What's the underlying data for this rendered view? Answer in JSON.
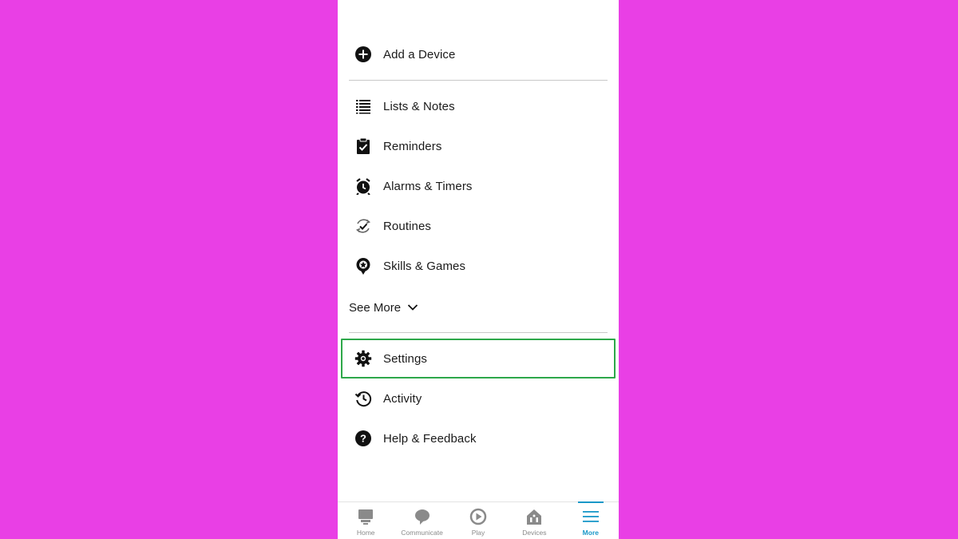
{
  "menu": {
    "add_device": "Add a Device",
    "items": [
      {
        "label": "Lists & Notes",
        "icon": "list-icon"
      },
      {
        "label": "Reminders",
        "icon": "clipboard-check-icon"
      },
      {
        "label": "Alarms & Timers",
        "icon": "alarm-clock-icon"
      },
      {
        "label": "Routines",
        "icon": "routine-check-icon"
      },
      {
        "label": "Skills & Games",
        "icon": "skills-badge-icon"
      }
    ],
    "see_more": "See More",
    "settings": "Settings",
    "activity": "Activity",
    "help": "Help & Feedback"
  },
  "tabbar": {
    "tabs": [
      {
        "label": "Home",
        "icon": "home-icon"
      },
      {
        "label": "Communicate",
        "icon": "chat-bubble-icon"
      },
      {
        "label": "Play",
        "icon": "play-icon"
      },
      {
        "label": "Devices",
        "icon": "devices-house-icon"
      },
      {
        "label": "More",
        "icon": "menu-lines-icon",
        "active": true
      }
    ]
  },
  "colors": {
    "background": "#e93fe5",
    "highlight": "#2ea84a",
    "accent": "#1a98c8"
  }
}
